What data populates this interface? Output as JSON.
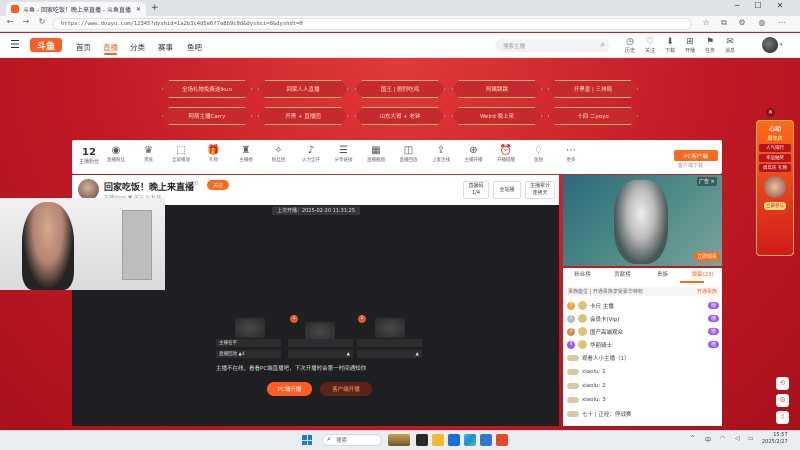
{
  "browser": {
    "tab_title": "斗鱼 - 回家吃饭！晚上来直播 - 斗鱼直播",
    "new_tab": "+",
    "url": "https://www.douyu.com/12345?dyshid=1a2b3c4d5e6f7a8b9c0d&dyshci=8&dyshdt=0"
  },
  "site": {
    "logo": "斗鱼",
    "nav": [
      "首页",
      "直播",
      "分类",
      "赛事",
      "鱼吧"
    ],
    "search_placeholder": "搜索主播",
    "header_icons": [
      {
        "glyph": "◷",
        "label": "历史"
      },
      {
        "glyph": "♡",
        "label": "关注"
      },
      {
        "glyph": "⬇",
        "label": "下载"
      },
      {
        "glyph": "⊞",
        "label": "开播"
      },
      {
        "glyph": "⚑",
        "label": "任务"
      },
      {
        "glyph": "✉",
        "label": "消息"
      }
    ]
  },
  "banner_tags": [
    [
      "全场礼物免费送ikun",
      "回家人人直播",
      "国王 | 剧烈吃鸡",
      "阿姨跳跳",
      "开黑皇 | 三排局"
    ],
    [
      "阿萌主播Carry",
      "开黑 + 直播团",
      "山东大哥 + 老钟",
      "Weird 晚上来",
      "十四 二yoyo"
    ]
  ],
  "side_ad": {
    "title": "心动",
    "subtitle": "周年庆",
    "items": [
      "人气排行",
      "幸运抽奖",
      "周年庆 礼物"
    ],
    "button": "立即参与"
  },
  "toolbar": {
    "fans_count": "12",
    "fans_label": "主播粉丝",
    "items": [
      {
        "glyph": "◉",
        "label": "直播粉丝"
      },
      {
        "glyph": "♛",
        "label": "贵族"
      },
      {
        "glyph": "⬚",
        "label": "全屏播放"
      },
      {
        "glyph": "🎁",
        "label": "礼物"
      },
      {
        "glyph": "♜",
        "label": "主播榜"
      },
      {
        "glyph": "✧",
        "label": "粉丝团"
      },
      {
        "glyph": "♪",
        "label": "火力全开"
      },
      {
        "glyph": "☰",
        "label": "分享链接"
      },
      {
        "glyph": "▦",
        "label": "直播截图"
      },
      {
        "glyph": "◫",
        "label": "直播回放"
      },
      {
        "glyph": "⇪",
        "label": "上麦连线"
      },
      {
        "glyph": "⊕",
        "label": "主播开播"
      },
      {
        "glyph": "⏰",
        "label": "开播提醒"
      },
      {
        "glyph": "♢",
        "label": "鱼翅"
      },
      {
        "glyph": "⋯",
        "label": "更多"
      }
    ],
    "pc_button": "PC客户端",
    "pc_sub": "客户端下载"
  },
  "room": {
    "title": "回家吃饭！晚上来直播",
    "level": "LV30",
    "follow": "关注",
    "host_sub": "主播Vooe  ♥ 关注  ✉ 私信",
    "buttons": [
      "直播码 1/4",
      "全站播",
      "主播累计 连续天"
    ]
  },
  "video": {
    "top_text": "上次开播：2025-02-20 11:31:25",
    "thumbs": [
      {
        "badge": "1",
        "title": "主播名字",
        "meta": "直播回放  ▲4"
      },
      {
        "badge": "2",
        "title": "",
        "meta": "▲"
      },
      {
        "badge": "3",
        "title": "",
        "meta": "▲"
      }
    ],
    "offline_text": "主播不在线，看看PC端直播吧，下次开播时会第一时间通知你",
    "pc_open": "PC端开播",
    "app_open": "客户端开播"
  },
  "ad": {
    "tag": "广告 ✕",
    "button": "立即观看"
  },
  "chat": {
    "tabs": [
      "粉丝榜",
      "贡献榜",
      "贵族",
      "弹幕(23)"
    ],
    "noble_bar": "贵族座位 | 开通贵族享受豪华特权",
    "noble_btn": "开通贵族",
    "rank": [
      {
        "rank": "1",
        "name": "卡尺 主播",
        "count": "榜"
      },
      {
        "rank": "2",
        "name": "会员卡(Vip)",
        "count": "榜"
      },
      {
        "rank": "3",
        "name": "国产高端观众",
        "count": "榜"
      },
      {
        "rank": "4",
        "name": "华丽骑士",
        "count": "榜"
      }
    ],
    "messages": [
      "观看人小主播（1）",
      "xiaolu:  1",
      "xiaolu:  2",
      "xiaolu:  3",
      "七十 | 正经：停战赛"
    ]
  },
  "taskbar": {
    "search": "搜索",
    "time": "15:57",
    "date": "2025/2/27"
  }
}
